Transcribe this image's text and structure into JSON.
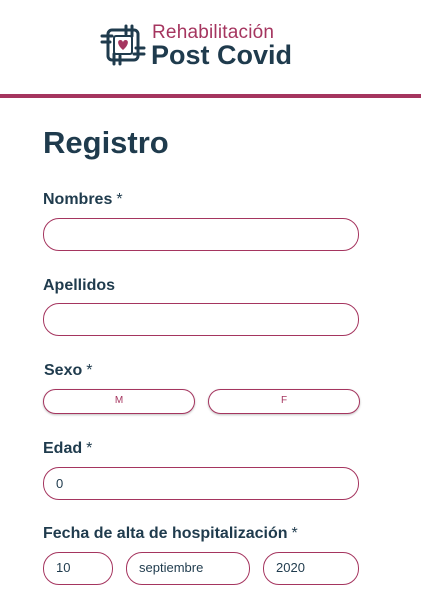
{
  "header": {
    "brand_top": "Rehabilitación",
    "brand_bottom": "Post Covid",
    "logo_icon": "hands-heart-icon",
    "accent_color": "#a5355f",
    "text_color": "#1f3b4d"
  },
  "form": {
    "title": "Registro",
    "required_mark": "*",
    "nombres": {
      "label": "Nombres",
      "value": ""
    },
    "apellidos": {
      "label": "Apellidos",
      "value": ""
    },
    "sexo": {
      "label": "Sexo",
      "options": [
        "M",
        "F"
      ]
    },
    "edad": {
      "label": "Edad",
      "value": "0"
    },
    "fecha_alta": {
      "label": "Fecha de alta de hospitalización",
      "day": "10",
      "month": "septiembre",
      "year": "2020"
    }
  }
}
